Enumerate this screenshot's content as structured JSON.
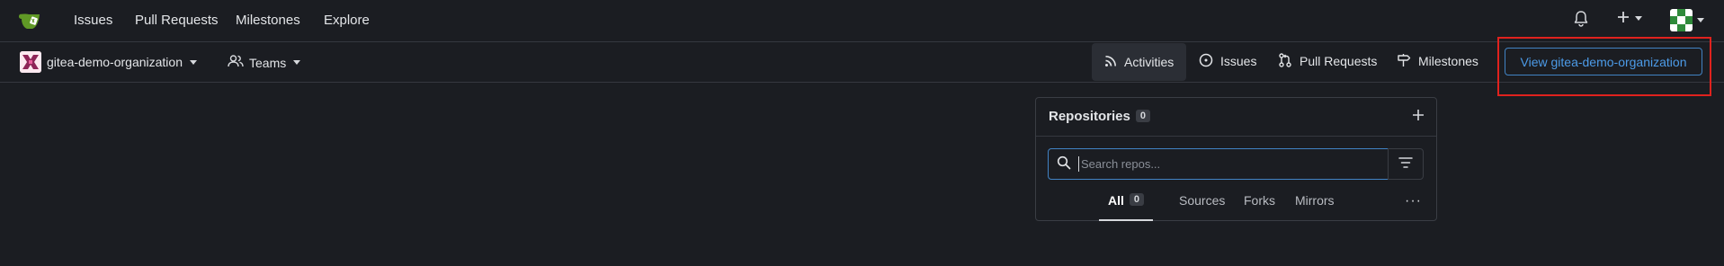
{
  "topnav": {
    "items": [
      {
        "label": "Issues"
      },
      {
        "label": "Pull Requests"
      },
      {
        "label": "Milestones"
      },
      {
        "label": "Explore"
      }
    ],
    "icons": {
      "notifications": "bell-icon",
      "create": "plus-icon",
      "avatar": "user-avatar"
    }
  },
  "org": {
    "name": "gitea-demo-organization",
    "teams_label": "Teams"
  },
  "org_tabs": [
    {
      "label": "Activities",
      "icon": "rss-icon",
      "active": true
    },
    {
      "label": "Issues",
      "icon": "issue-opened-icon"
    },
    {
      "label": "Pull Requests",
      "icon": "git-pull-request-icon"
    },
    {
      "label": "Milestones",
      "icon": "milestone-icon"
    }
  ],
  "view_button": {
    "label": "View gitea-demo-organization"
  },
  "repositories": {
    "title": "Repositories",
    "count": "0",
    "search_placeholder": "Search repos...",
    "filters": [
      {
        "label": "All",
        "count": "0",
        "active": true
      },
      {
        "label": "Sources"
      },
      {
        "label": "Forks"
      },
      {
        "label": "Mirrors"
      }
    ],
    "more_label": "···"
  },
  "colors": {
    "background": "#1b1d22",
    "accent": "#4183c4",
    "highlight": "#e0221e"
  }
}
